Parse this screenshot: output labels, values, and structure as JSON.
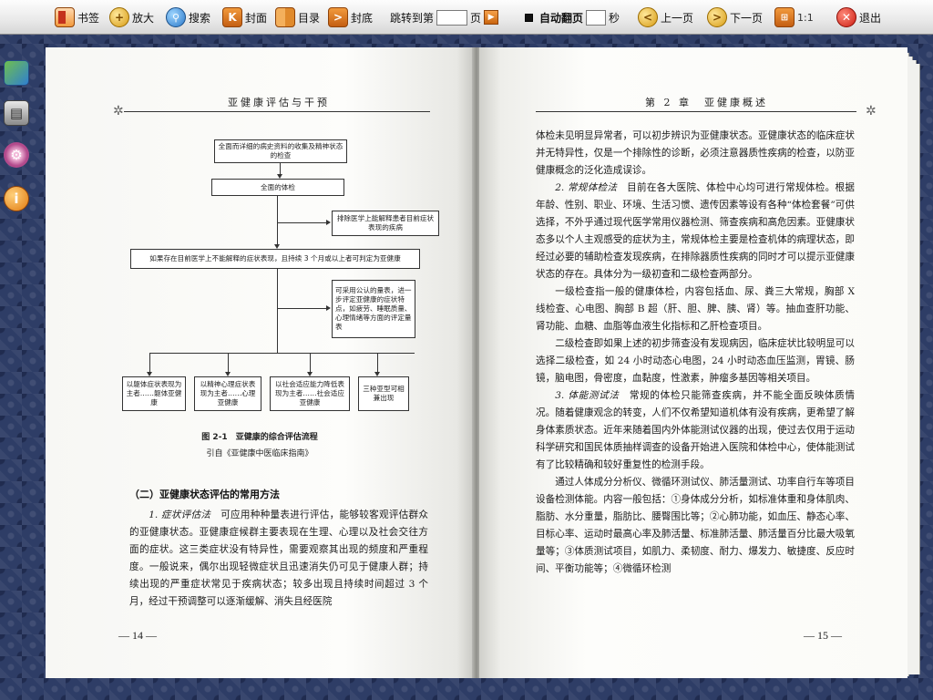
{
  "toolbar": {
    "bookmark": "书签",
    "zoom": "放大",
    "search": "搜索",
    "cover": "封面",
    "toc": "目录",
    "back_cover": "封底",
    "jump_prefix": "跳转到第",
    "jump_suffix": "页",
    "auto_flip": "自动翻页",
    "seconds": "秒",
    "prev": "上一页",
    "next": "下一页",
    "ratio": "1:1",
    "exit": "退出"
  },
  "sidebar_icons": [
    "picture-icon",
    "printer-icon",
    "settings-icon",
    "info-icon"
  ],
  "left_page": {
    "header": "亚健康评估与干预",
    "flowchart": {
      "box1": "全面而详细的病史资料的收集及精神状态的检查",
      "box2": "全面的体检",
      "box3": "排除医学上能解释患者目前症状表现的疾病",
      "box4": "如果存在目前医学上不能解释的症状表现，且持续 3 个月或以上者可判定为亚健康",
      "box5": "可采用公认的量表，进一步评定亚健康的症状特点，如疲劳、睡眠质量、心理情绪等方面的评定量表",
      "out1": "以躯体症状表现为主者……躯体亚健康",
      "out2": "以精神心理症状表现为主者……心理亚健康",
      "out3": "以社会适应能力降低表现为主者……社会适应亚健康",
      "out4": "三种亚型可相兼出现"
    },
    "figure_caption": "图 2-1　亚健康的综合评估流程",
    "figure_source": "引自《亚健康中医临床指南》",
    "section_title": "（二）亚健康状态评估的常用方法",
    "para1_lead": "1. 症状评估法",
    "para1": "　可应用种种量表进行评估，能够较客观评估群众的亚健康状态。亚健康症候群主要表现在生理、心理以及社会交往方面的症状。这三类症状没有特异性，需要观察其出现的频度和严重程度。一般说来，偶尔出现轻微症状且迅速消失仍可见于健康人群；持续出现的严重症状常见于疾病状态；较多出现且持续时间超过 3 个月，经过干预调整可以逐渐缓解、消失且经医院",
    "page_number": "— 14 —"
  },
  "right_page": {
    "header": "第 2 章　亚健康概述",
    "p1": "体检未见明显异常者，可以初步辨识为亚健康状态。亚健康状态的临床症状并无特异性，仅是一个排除性的诊断，必须注意器质性疾病的检查，以防亚健康概念的泛化造成误诊。",
    "p2_lead": "2. 常规体检法",
    "p2": "　目前在各大医院、体检中心均可进行常规体检。根据年龄、性别、职业、环境、生活习惯、遗传因素等设有各种“体检套餐”可供选择，不外乎通过现代医学常用仪器检测、筛查疾病和高危因素。亚健康状态多以个人主观感受的症状为主，常规体检主要是检查机体的病理状态，即经过必要的辅助检查发现疾病，在排除器质性疾病的同时才可以提示亚健康状态的存在。具体分为一级初查和二级检查两部分。",
    "p3": "一级检查指一般的健康体检，内容包括血、尿、粪三大常规，胸部 X 线检查、心电图、胸部 B 超（肝、胆、脾、胰、肾）等。抽血查肝功能、肾功能、血糖、血脂等血液生化指标和乙肝检查项目。",
    "p4": "二级检查即如果上述的初步筛查没有发现病因，临床症状比较明显可以选择二级检查，如 24 小时动态心电图，24 小时动态血压监测，胃镜、肠镜，脑电图，骨密度，血黏度，性激素，肿瘤多基因等相关项目。",
    "p5_lead": "3. 体能测试法",
    "p5": "　常规的体检只能筛查疾病，并不能全面反映体质情况。随着健康观念的转变，人们不仅希望知道机体有没有疾病，更希望了解身体素质状态。近年来随着国内外体能测试仪器的出现，使过去仅用于运动科学研究和国民体质抽样调查的设备开始进入医院和体检中心，使体能测试有了比较精确和较好重复性的检测手段。",
    "p6": "通过人体成分分析仪、微循环测试仪、肺活量测试、功率自行车等项目设备检测体能。内容一般包括：①身体成分分析，如标准体重和身体肌肉、脂肪、水分重量，脂肪比、腰臀围比等；②心肺功能，如血压、静态心率、目标心率、运动时最高心率及肺活量、标准肺活量、肺活量百分比最大吸氧量等；③体质测试项目，如肌力、柔韧度、耐力、爆发力、敏捷度、反应时间、平衡功能等；④微循环检测",
    "page_number": "— 15 —"
  }
}
